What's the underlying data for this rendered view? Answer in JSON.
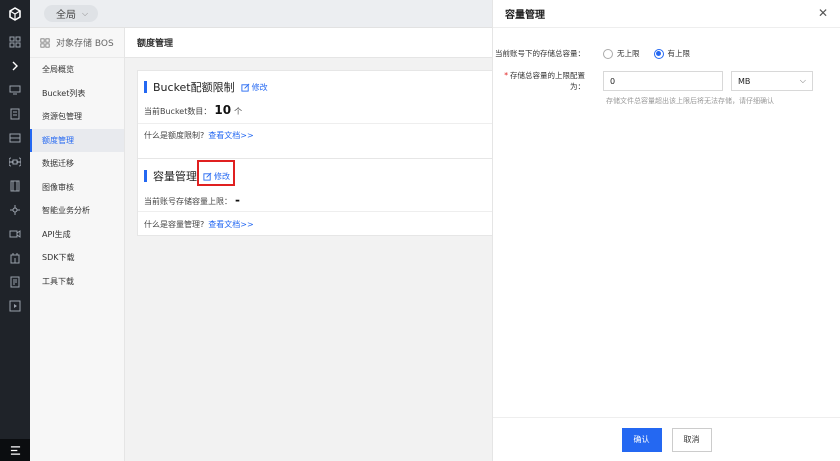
{
  "topbar": {
    "region_label": "全局"
  },
  "sidebar": {
    "product_name": "对象存储 BOS",
    "items": [
      {
        "label": "全局概览"
      },
      {
        "label": "Bucket列表"
      },
      {
        "label": "资源包管理"
      },
      {
        "label": "额度管理"
      },
      {
        "label": "数据迁移"
      },
      {
        "label": "图像审核"
      },
      {
        "label": "智能业务分析"
      },
      {
        "label": "API生成"
      },
      {
        "label": "SDK下载"
      },
      {
        "label": "工具下载"
      }
    ],
    "active_index": 3
  },
  "main": {
    "title": "额度管理",
    "bucket_card": {
      "title": "Bucket配额限制",
      "edit_label": "修改",
      "count_label": "当前Bucket数目：",
      "count_value": "10",
      "count_unit": "个",
      "question": "什么是额度限制?",
      "doc_link": "查看文档>>"
    },
    "capacity_card": {
      "title": "容量管理",
      "edit_label": "修改",
      "limit_label": "当前账号存储容量上限：",
      "limit_value": "-",
      "question": "什么是容量管理?",
      "doc_link": "查看文档>>"
    }
  },
  "drawer": {
    "title": "容量管理",
    "row1_label": "当前账号下的存储总容量：",
    "option_unlimited": "无上限",
    "option_limited": "有上限",
    "row2_label": "存储总容量的上限配置为：",
    "capacity_value": "0",
    "unit_value": "MB",
    "hint": "存储文件总容量超出该上限后将无法存储，请仔细确认",
    "confirm_label": "确认",
    "cancel_label": "取消"
  },
  "colors": {
    "accent": "#2468f2",
    "highlight_box": "#e02020",
    "rail": "#1f2329"
  }
}
